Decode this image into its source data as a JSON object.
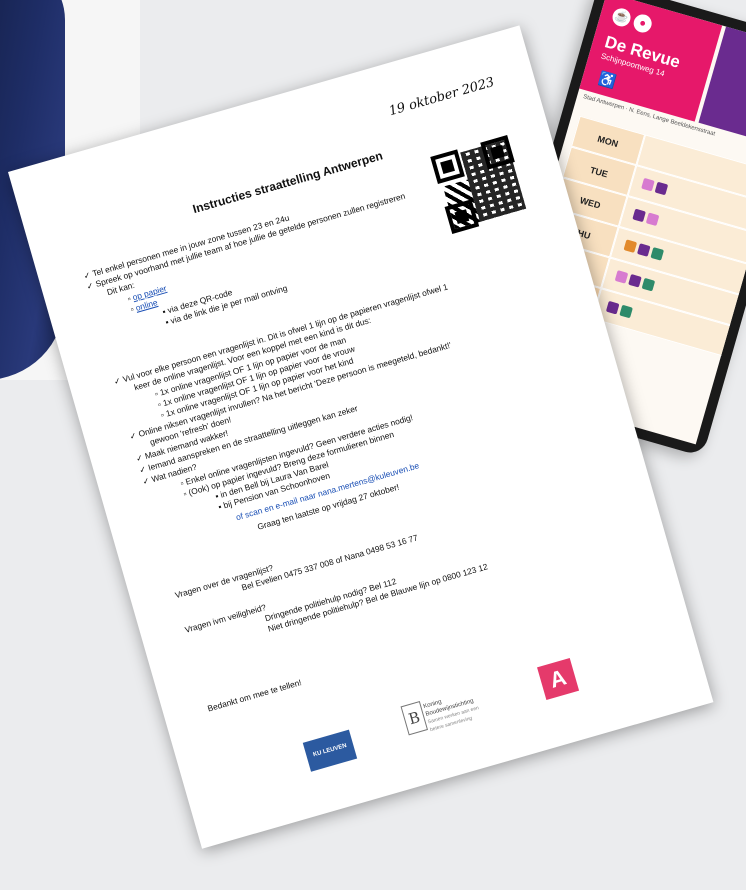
{
  "document": {
    "date": "19 oktober 2023",
    "title": "Instructies straattelling Antwerpen",
    "items": [
      "Tel enkel personen mee in jouw zone tussen 23 en 24u",
      "Spreek op voorhand met jullie team af hoe jullie de getelde personen zullen registreren",
      "Dit kan:",
      "op papier",
      "online",
      "via deze QR-code",
      "via de link die je per mail ontving",
      "Vul voor elke persoon een vragenlijst in. Dit is ofwel 1 lijn op de papieren vragenlijst ofwel 1",
      "keer de online vragenlijst. Voor een koppel met een kind is dit dus:",
      "1x online vragenlijst OF 1 lijn op papier voor de man",
      "1x online vragenlijst OF 1 lijn op papier voor de vrouw",
      "1x online vragenlijst OF 1 lijn op papier voor het kind",
      "Online niksen vragenlijst invullen? Na het bericht 'Deze persoon is meegeteld, bedankt!'",
      "gewoon 'refresh' doen!",
      "Maak niemand wakker!",
      "Iemand aanspreken en de straattelling uitleggen kan zeker",
      "Wat nadien?",
      "Enkel online vragenlijsten ingevuld? Geen verdere acties nodig!",
      "(Ook) op papier ingevuld? Breng deze formulieren binnen",
      "in den Bell bij Laura Van Barel",
      "bij Pension van Schoonhoven",
      "of scan en e-mail naar nana.mertens@kuleuven.be",
      "Graag ten laatste op vrijdag 27 oktober!",
      "Vragen over de vragenlijst?",
      "Bel Evelien 0475 337 008 of Nana 0498 53 16 77",
      "Vragen ivm veiligheid?",
      "Dringende politiehulp nodig? Bel 112",
      "Niet dringende politiehulp? Bel de Blauwe lijn op 0800 123 12",
      "Bedankt om mee te tellen!"
    ],
    "logos": {
      "ku": "KU LEUVEN",
      "koning": "Koning Boudewijnstichting",
      "koning_sub": "Samen werken aan een betere samenleving",
      "antwerpen": "A"
    }
  },
  "tablet": {
    "venue": "De Revue",
    "address": "Schijnpoortweg 14",
    "caption": "Stad Antwerpen · N. Eens, Lange Beeldekensstraat",
    "days": [
      "MON",
      "TUE",
      "WED",
      "THU",
      "FRI"
    ]
  },
  "colors": {
    "paper": "#ffffff",
    "background": "#ebecee",
    "revue_pink": "#e6186a",
    "revue_purple": "#6a2b8f",
    "link": "#1a4fb5",
    "antwerpen_red": "#e53a6b",
    "ku_blue": "#2c5aa0"
  }
}
